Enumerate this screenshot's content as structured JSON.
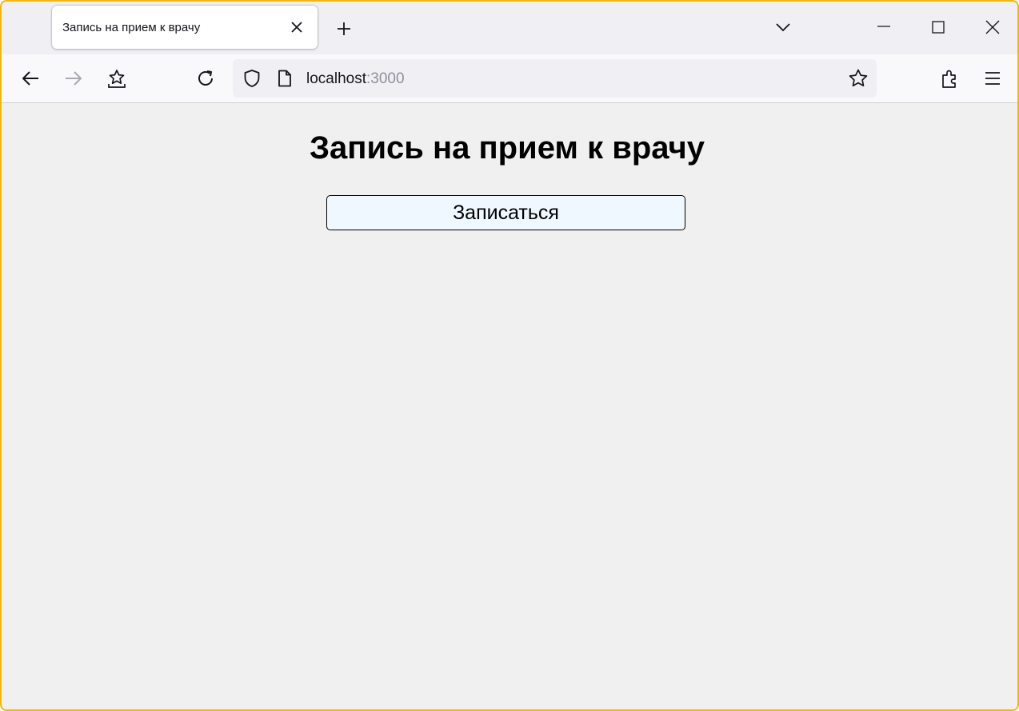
{
  "browser": {
    "tab": {
      "title": "Запись на прием к врачу"
    },
    "url": {
      "host": "localhost",
      "port": ":3000"
    }
  },
  "page": {
    "title": "Запись на прием к врачу",
    "signup_button": "Записаться"
  },
  "colors": {
    "window_border": "#f5b800",
    "page_background": "#f0f0f0",
    "button_background": "#f0f8ff"
  },
  "icons": [
    "close-icon",
    "plus-icon",
    "chevron-down-icon",
    "minimize-icon",
    "maximize-icon",
    "back-arrow-icon",
    "forward-arrow-icon",
    "import-bookmark-icon",
    "reload-icon",
    "shield-icon",
    "page-icon",
    "star-icon",
    "extensions-icon",
    "menu-icon"
  ]
}
